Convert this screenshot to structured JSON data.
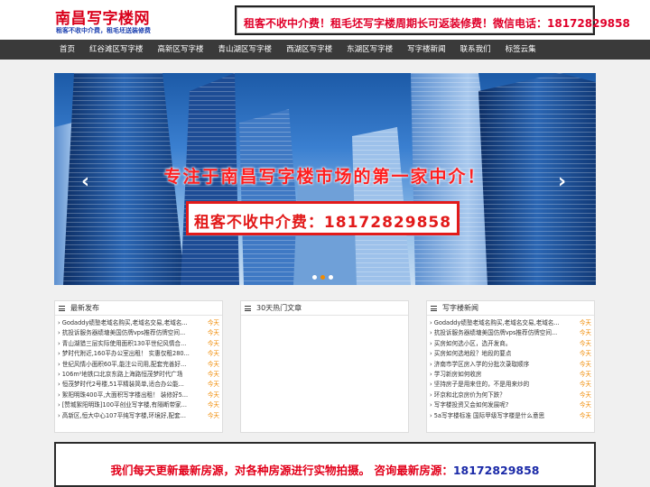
{
  "header": {
    "site_title": "南昌写字楼网",
    "tagline": "租客不收中介费，租毛坯送装修费",
    "banner_text": "租客不收中介费！租毛坯写字楼周期长可返装修费！微信电话：18172829858"
  },
  "nav": {
    "items": [
      "首页",
      "红谷滩区写字楼",
      "高新区写字楼",
      "青山湖区写字楼",
      "西湖区写字楼",
      "东湖区写字楼",
      "写字楼新闻",
      "联系我们",
      "标签云集"
    ]
  },
  "slider": {
    "headline": "专注于南昌写字楼市场的第一家中介！",
    "phone_text": "租客不收中介费：18172829858",
    "prev_arrow": "‹",
    "next_arrow": "›",
    "dot_count": 3,
    "active_dot": 1
  },
  "panels": {
    "latest": {
      "title": "最新发布",
      "items": [
        {
          "title": "Godaddy绩塾老域名购买,老域名交易,老域名...",
          "date": "今天"
        },
        {
          "title": "抗投诉服务器绩塘美国仿牌vps推荐仿牌空间...",
          "date": "今天"
        },
        {
          "title": "青山湖猎三层实际使用面积130平世纪风情合...",
          "date": "今天"
        },
        {
          "title": "梦时代附近,160平办公室出租！ 实惠仅租280...",
          "date": "今天"
        },
        {
          "title": "世纪风情小面积60平,能注公司用,配套完善好...",
          "date": "今天"
        },
        {
          "title": "106m²地铁口北京东路上海路恒茂梦时代广场",
          "date": "今天"
        },
        {
          "title": "恒茂梦时代2号楼,51平精装简单,适合办公能...",
          "date": "今天"
        },
        {
          "title": "絮阳明珠400平,大面积写字楼出租！ 装修好5...",
          "date": "今天"
        },
        {
          "title": "[赞城絮阳明珠]100平创业写字楼,有隔断带家...",
          "date": "今天"
        },
        {
          "title": "高新区,恒大中心107平纯写字楼,环境好,配套...",
          "date": "今天"
        }
      ]
    },
    "hot": {
      "title": "30天热门文章",
      "items": []
    },
    "news": {
      "title": "写字楼新闻",
      "items": [
        {
          "title": "Godaddy绩塾老域名购买,老域名交易,老域名...",
          "date": "今天"
        },
        {
          "title": "抗投诉服务器绩塘美国仿牌vps推荐仿牌空间...",
          "date": "今天"
        },
        {
          "title": "买房如何选小区，选开发商。",
          "date": "今天"
        },
        {
          "title": "买房如何选地段？地段的要点",
          "date": "今天"
        },
        {
          "title": "济南市学区房入学的分批次录取顺序",
          "date": "今天"
        },
        {
          "title": "学习新房如何收房",
          "date": "今天"
        },
        {
          "title": "坚持房子是用来住的，不是用来炒的",
          "date": "今天"
        },
        {
          "title": "环京和北京房价为何下跌？",
          "date": "今天"
        },
        {
          "title": "写字楼投资又会如何发展呢?",
          "date": "今天"
        },
        {
          "title": "5a写字楼标准 国际甲级写字楼是什么意思",
          "date": "今天"
        }
      ]
    }
  },
  "bottom_banner": {
    "text": "我们每天更新最新房源，对各种房源进行实物拍摄。 咨询最新房源：",
    "phone": "18172829858"
  },
  "colors": {
    "brand_red": "#d9001b",
    "nav_bg": "#3a3a3a",
    "date_orange": "#f08a00",
    "phone_blue": "#1b2aa8"
  }
}
